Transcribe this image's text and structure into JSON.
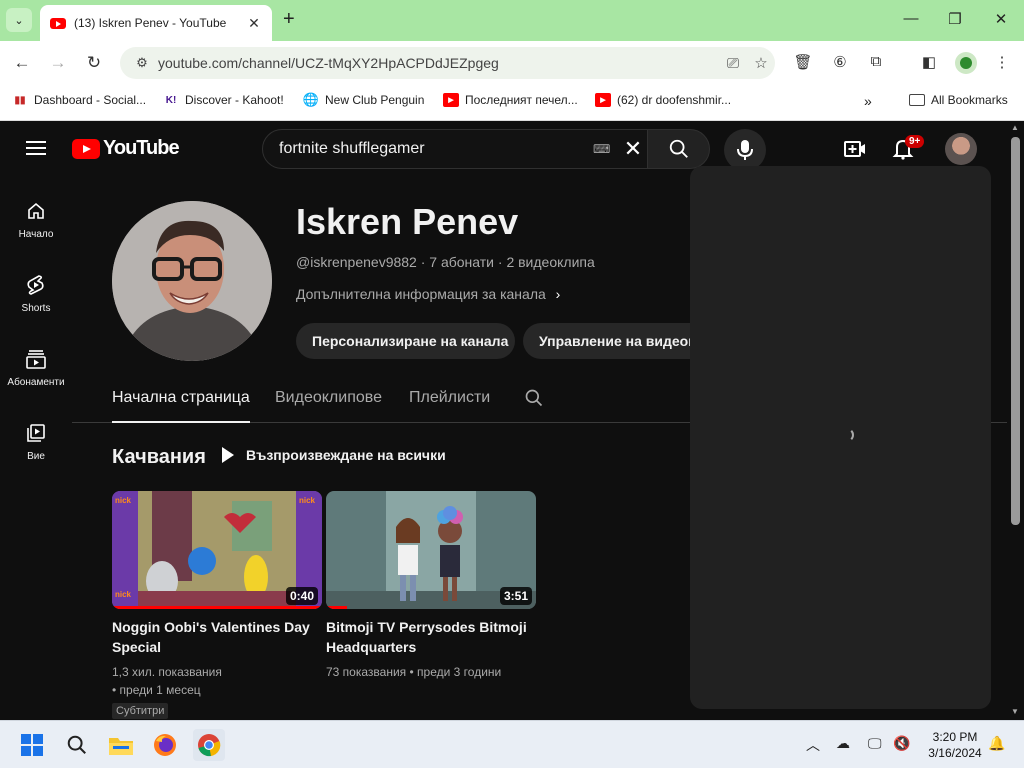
{
  "browser": {
    "tab_title": "(13) Iskren Penev - YouTube",
    "url": "youtube.com/channel/UCZ-tMqXY2HpACPDdJEZpgeg",
    "bookmarks": [
      {
        "label": "Dashboard - Social...",
        "icon": "chart-bars-icon"
      },
      {
        "label": "Discover - Kahoot!",
        "icon": "kahoot-icon"
      },
      {
        "label": "New Club Penguin",
        "icon": "globe-icon"
      },
      {
        "label": "Последният печел...",
        "icon": "youtube-icon"
      },
      {
        "label": "(62) dr doofenshmir...",
        "icon": "youtube-icon"
      }
    ],
    "all_bookmarks": "All Bookmarks"
  },
  "youtube": {
    "logo": "YouTube",
    "search_query": "fortnite shufflegamer",
    "notification_count": "9+",
    "guide": [
      {
        "label": "Начало",
        "icon": "home-icon"
      },
      {
        "label": "Shorts",
        "icon": "shorts-icon"
      },
      {
        "label": "Абонаменти",
        "icon": "subscriptions-icon"
      },
      {
        "label": "Вие",
        "icon": "you-icon"
      }
    ],
    "channel": {
      "name": "Iskren Penev",
      "meta": "@iskrenpenev9882 · 7 абонати · 2 видеоклипа",
      "more_info": "Допълнителна информация за канала",
      "customize_button": "Персонализиране на канала",
      "manage_button": "Управление на видеоклипове"
    },
    "tabs": [
      "Начална страница",
      "Видеоклипове",
      "Плейлисти"
    ],
    "shelf": {
      "title": "Качвания",
      "play_all": "Възпроизвеждане на всички",
      "videos": [
        {
          "title": "Noggin Oobi's Valentines Day Special",
          "duration": "0:40",
          "views": "1,3 хил. показвания",
          "age": "• преди 1 месец",
          "badge": "Субтитри",
          "watched_fraction": 1.0
        },
        {
          "title": "Bitmoji TV Perrysodes Bitmoji Headquarters",
          "duration": "3:51",
          "views": "73 показвания",
          "age": "• преди 3 години",
          "watched_fraction": 0.1
        }
      ]
    }
  },
  "taskbar": {
    "time": "3:20 PM",
    "date": "3/16/2024"
  },
  "colors": {
    "tabstrip": "#a8e6a3",
    "youtube_red": "#ff0000",
    "page_bg": "#0f0f0f"
  }
}
